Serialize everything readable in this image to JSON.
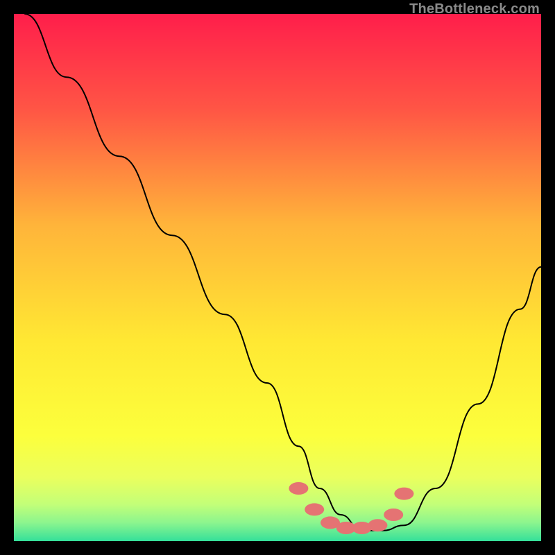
{
  "watermark": "TheBottleneck.com",
  "chart_data": {
    "type": "line",
    "title": "",
    "xlabel": "",
    "ylabel": "",
    "xlim": [
      0,
      100
    ],
    "ylim": [
      0,
      100
    ],
    "grid": false,
    "legend": false,
    "background_gradient_stops": [
      {
        "pos": 0.0,
        "color": "#ff1e4b"
      },
      {
        "pos": 0.18,
        "color": "#ff5545"
      },
      {
        "pos": 0.4,
        "color": "#ffb43a"
      },
      {
        "pos": 0.62,
        "color": "#ffe833"
      },
      {
        "pos": 0.8,
        "color": "#fcff3c"
      },
      {
        "pos": 0.88,
        "color": "#eaff5e"
      },
      {
        "pos": 0.93,
        "color": "#c3ff78"
      },
      {
        "pos": 0.965,
        "color": "#8cf58e"
      },
      {
        "pos": 1.0,
        "color": "#34e09a"
      }
    ],
    "series": [
      {
        "name": "bottleneck-curve",
        "stroke": "#000000",
        "x": [
          2,
          10,
          20,
          30,
          40,
          48,
          54,
          58,
          62,
          66,
          70,
          74,
          80,
          88,
          96,
          100
        ],
        "y": [
          100,
          88,
          73,
          58,
          43,
          30,
          18,
          10,
          5,
          2,
          2,
          3,
          10,
          26,
          44,
          52
        ]
      }
    ],
    "markers": {
      "name": "optimal-zone",
      "color": "#e57373",
      "points": [
        {
          "x": 54,
          "y": 10
        },
        {
          "x": 57,
          "y": 6
        },
        {
          "x": 60,
          "y": 3.5
        },
        {
          "x": 63,
          "y": 2.5
        },
        {
          "x": 66,
          "y": 2.5
        },
        {
          "x": 69,
          "y": 3
        },
        {
          "x": 72,
          "y": 5
        },
        {
          "x": 74,
          "y": 9
        }
      ]
    }
  }
}
